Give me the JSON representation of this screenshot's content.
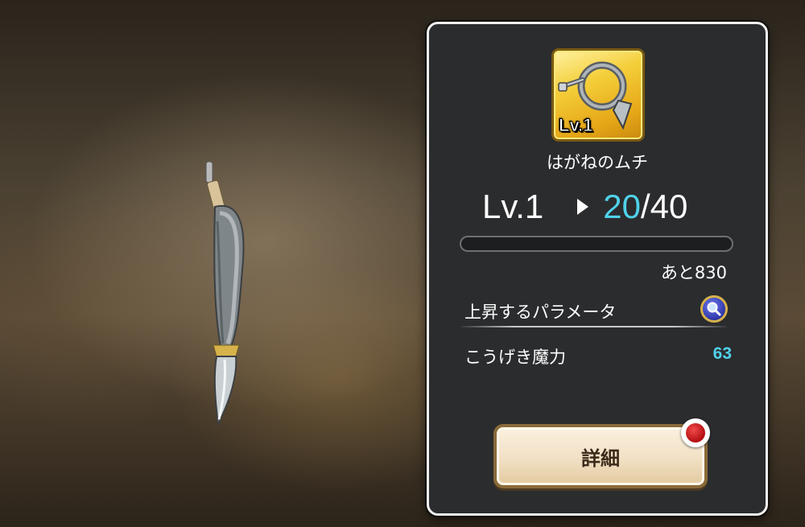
{
  "item": {
    "icon": "steel-whip-icon",
    "icon_level_badge": "Lv.1",
    "name": "はがねのムチ"
  },
  "level": {
    "current_label": "Lv.1",
    "current_points": "20",
    "separator": "/",
    "max_points": "40",
    "exp_progress": 0.0
  },
  "remaining_label": "あと830",
  "parameters": {
    "title": "上昇するパラメータ",
    "items": [
      {
        "name": "こうげき魔力",
        "value": "63"
      }
    ]
  },
  "detail_button": {
    "label": "詳細",
    "has_notification": true
  },
  "colors": {
    "accent": "#4fd2ea",
    "panel": "#2b2c2e",
    "badge": "#c8101a"
  }
}
